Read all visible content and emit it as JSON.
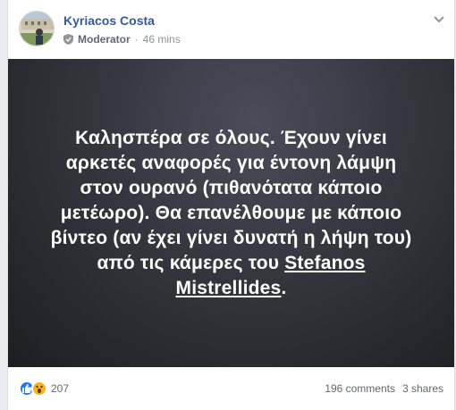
{
  "post": {
    "author": "Kyriacos Costa",
    "role": "Moderator",
    "separator": "·",
    "time": "46 mins",
    "text_parts": [
      "Καλησπέρα σε όλους. Έχουν γίνει αρκετές αναφορές για έντονη λάμψη στον ουρανό (πιθανότατα κάποιο μετέωρο). Θα επανέλθουμε με κάποιο βίντεο (αν έχει γίνει δυνατή η λήψη του) από τις κάμερες του ",
      "Stefanos Mistrellides",
      "."
    ],
    "background_colors": [
      "#4a4d59",
      "#1d1e22"
    ]
  },
  "reactions": {
    "count": "207",
    "types": [
      "like-icon",
      "wow-icon"
    ]
  },
  "stats": {
    "comments": "196 comments",
    "shares": "3 shares"
  }
}
